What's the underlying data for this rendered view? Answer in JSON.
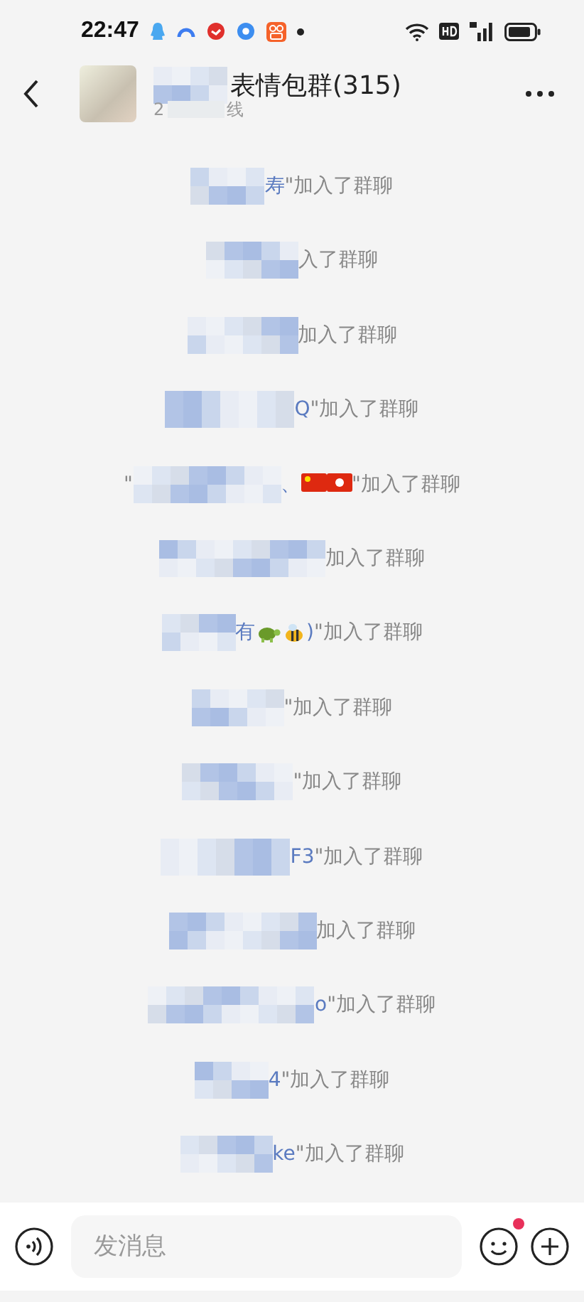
{
  "status_bar": {
    "time": "22:47"
  },
  "header": {
    "title": "表情包群(315)",
    "subtitle_start": "2",
    "subtitle_end": "线"
  },
  "messages": [
    {
      "segments": [
        {
          "kind": "text",
          "text": "寿"
        }
      ],
      "suffix": "\"加入了群聊"
    },
    {
      "suffix": "入了群聊"
    },
    {
      "suffix": "加入了群聊"
    },
    {
      "segments": [
        {
          "kind": "text",
          "text": "Q"
        }
      ],
      "suffix": "\"加入了群聊"
    },
    {
      "lead": "\"",
      "segments": [
        {
          "kind": "text",
          "text": "、"
        },
        {
          "kind": "flag-cn"
        },
        {
          "kind": "flag-hk"
        }
      ],
      "suffix": "\"加入了群聊"
    },
    {
      "suffix": "加入了群聊"
    },
    {
      "segments": [
        {
          "kind": "text",
          "text": "有"
        },
        {
          "kind": "turtle"
        },
        {
          "kind": "bee"
        },
        {
          "kind": "text",
          "text": ")"
        }
      ],
      "suffix": "\"加入了群聊"
    },
    {
      "suffix": "\"加入了群聊"
    },
    {
      "suffix": "\"加入了群聊"
    },
    {
      "segments": [
        {
          "kind": "text",
          "text": "F3"
        }
      ],
      "suffix": "\"加入了群聊"
    },
    {
      "suffix": "加入了群聊"
    },
    {
      "segments": [
        {
          "kind": "text",
          "text": "o"
        }
      ],
      "suffix": "\"加入了群聊"
    },
    {
      "segments": [
        {
          "kind": "text",
          "text": "4"
        }
      ],
      "suffix": "\"加入了群聊"
    },
    {
      "segments": [
        {
          "kind": "text",
          "text": "ke"
        }
      ],
      "suffix": "\"加入了群聊"
    }
  ],
  "input_bar": {
    "placeholder": "发消息",
    "emoji_badge": true
  }
}
